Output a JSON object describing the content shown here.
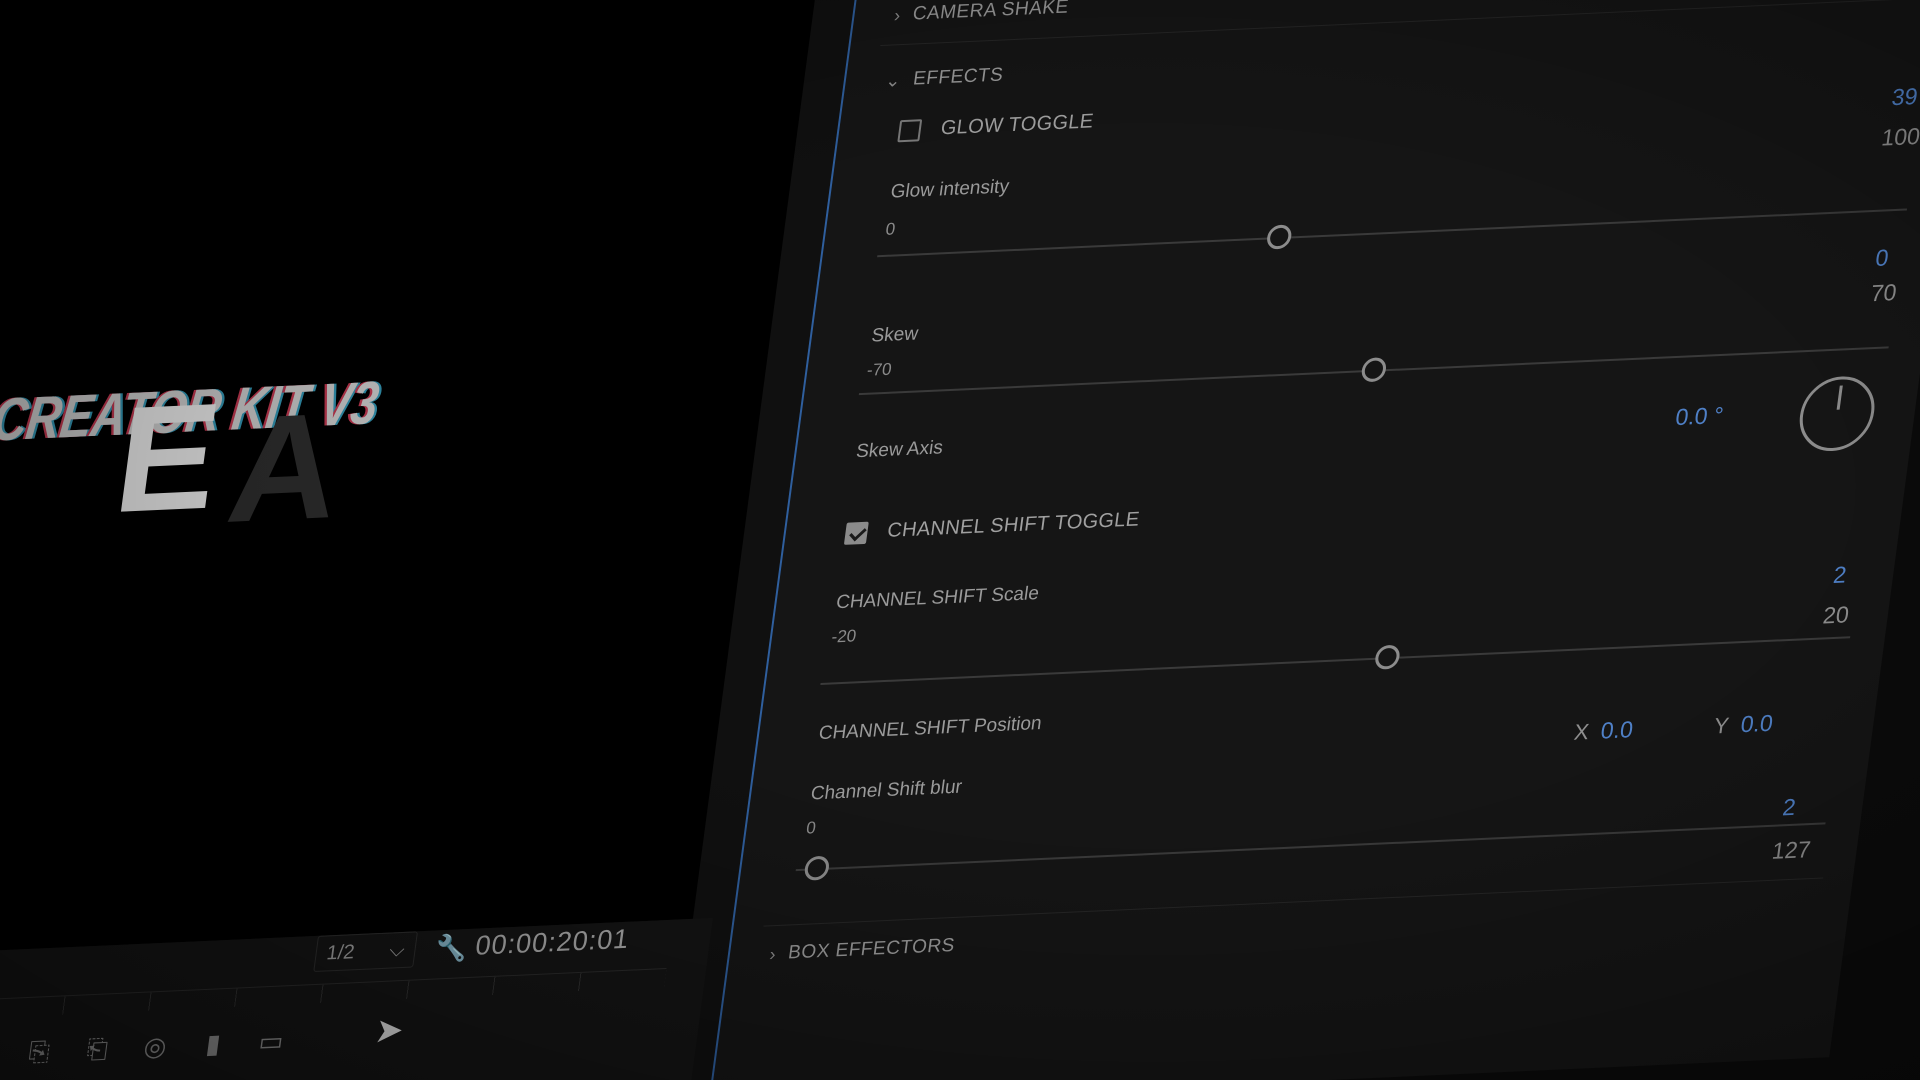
{
  "monitor": {
    "title_text": "O CREATOR KIT V3",
    "logo_e": "E",
    "logo_a": "A",
    "zoom": "1/2",
    "zoom_chevron": "⌵",
    "wrench": "🔧",
    "timecode": "00:00:20:01",
    "tools": [
      "▶",
      "→|",
      "⎘",
      "⎗",
      "◎",
      "▮",
      "▭"
    ],
    "cursor": "➤"
  },
  "effects_panel": {
    "camera_shake": {
      "label": "CAMERA SHAKE",
      "expanded": false
    },
    "effects": {
      "label": "EFFECTS",
      "expanded": true
    },
    "glow_toggle": {
      "label": "GLOW TOGGLE",
      "checked": false
    },
    "glow_intensity": {
      "label": "Glow intensity",
      "min": "0",
      "value": "39",
      "max": "100",
      "fraction": 0.39
    },
    "skew": {
      "label": "Skew",
      "min": "-70",
      "value": "0",
      "max": "70",
      "fraction": 0.5
    },
    "skew_axis": {
      "label": "Skew Axis",
      "value": "0.0 °"
    },
    "channel_shift_toggle": {
      "label": "CHANNEL SHIFT TOGGLE",
      "checked": true
    },
    "channel_shift_scale": {
      "label": "CHANNEL SHIFT Scale",
      "min": "-20",
      "value": "2",
      "max": "20",
      "fraction": 0.55
    },
    "channel_shift_position": {
      "label": "CHANNEL SHIFT Position",
      "x_label": "X",
      "x": "0.0",
      "y_label": "Y",
      "y": "0.0"
    },
    "channel_shift_blur": {
      "label": "Channel Shift blur",
      "min": "0",
      "value": "2",
      "max": "127",
      "fraction": 0.02
    },
    "box_effectors": {
      "label": "BOX EFFECTORS",
      "expanded": false
    }
  },
  "colors": {
    "accent": "#4f80c7",
    "panel_edge": "#2f5f9e"
  }
}
